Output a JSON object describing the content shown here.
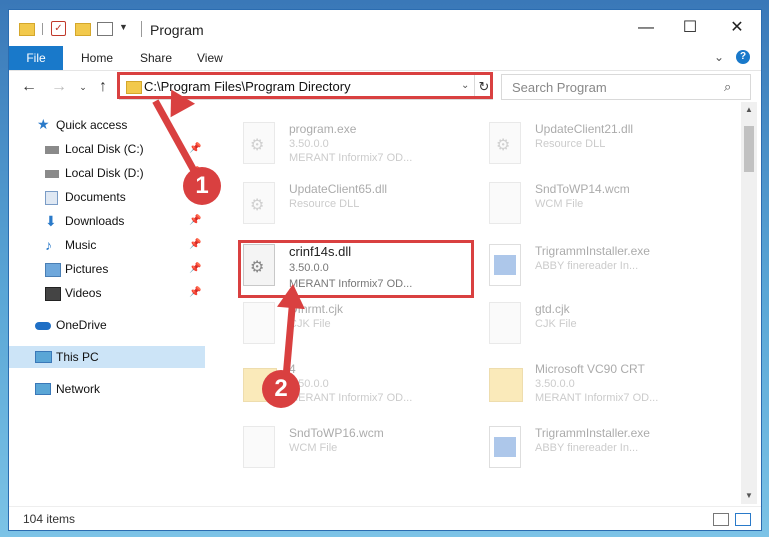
{
  "window": {
    "title": "Program",
    "controls": {
      "minimize": "—",
      "maximize": "☐",
      "close": "✕"
    }
  },
  "ribbon": {
    "tabs": [
      "File",
      "Home",
      "Share",
      "View"
    ]
  },
  "nav": {
    "address": "C:\\Program Files\\Program Directory",
    "search_placeholder": "Search Program"
  },
  "sidebar": {
    "items": [
      {
        "label": "Quick access",
        "icon": "star-icon",
        "pinned": false
      },
      {
        "label": "Local Disk (C:)",
        "icon": "drive-icon",
        "pinned": true
      },
      {
        "label": "Local Disk (D:)",
        "icon": "drive-icon",
        "pinned": true
      },
      {
        "label": "Documents",
        "icon": "documents-icon",
        "pinned": true
      },
      {
        "label": "Downloads",
        "icon": "download-icon",
        "pinned": true
      },
      {
        "label": "Music",
        "icon": "music-icon",
        "pinned": true
      },
      {
        "label": "Pictures",
        "icon": "pictures-icon",
        "pinned": true
      },
      {
        "label": "Videos",
        "icon": "videos-icon",
        "pinned": true
      },
      {
        "label": "OneDrive",
        "icon": "cloud-icon",
        "pinned": false
      },
      {
        "label": "This PC",
        "icon": "computer-icon",
        "pinned": false,
        "selected": true
      },
      {
        "label": "Network",
        "icon": "network-icon",
        "pinned": false
      }
    ]
  },
  "files": [
    {
      "name": "program.exe",
      "line2": "3.50.0.0",
      "line3": "MERANT Informix7 OD...",
      "icon": "gear-file-icon"
    },
    {
      "name": "UpdateClient21.dll",
      "line2": "Resource DLL",
      "line3": "",
      "icon": "gear-file-icon"
    },
    {
      "name": "UpdateClient65.dll",
      "line2": "Resource DLL",
      "line3": "",
      "icon": "gear-file-icon"
    },
    {
      "name": "SndToWP14.wcm",
      "line2": "WCM File",
      "line3": "",
      "icon": "blank-file-icon"
    },
    {
      "name": "crinf14s.dll",
      "line2": "3.50.0.0",
      "line3": "MERANT Informix7 OD...",
      "icon": "gear-file-icon"
    },
    {
      "name": "TrigrammInstaller.exe",
      "line2": "ABBY finereader In...",
      "line3": "",
      "icon": "installer-icon"
    },
    {
      "name": "Dfhrmt.cjk",
      "line2": "CJK File",
      "line3": "",
      "icon": "blank-file-icon"
    },
    {
      "name": "gtd.cjk",
      "line2": "CJK File",
      "line3": "",
      "icon": "blank-file-icon"
    },
    {
      "name": "4",
      "line2": "3.50.0.0",
      "line3": "MERANT Informix7 OD...",
      "icon": "folder-icon"
    },
    {
      "name": "Microsoft VC90 CRT",
      "line2": "3.50.0.0",
      "line3": "MERANT Informix7 OD...",
      "icon": "folder-icon"
    },
    {
      "name": "SndToWP16.wcm",
      "line2": "WCM File",
      "line3": "",
      "icon": "blank-file-icon"
    },
    {
      "name": "TrigrammInstaller.exe",
      "line2": "ABBY finereader In...",
      "line3": "",
      "icon": "installer-icon"
    }
  ],
  "status": {
    "item_count": "104 items"
  },
  "annotations": {
    "step1": "1",
    "step2": "2",
    "color": "#d94040"
  }
}
